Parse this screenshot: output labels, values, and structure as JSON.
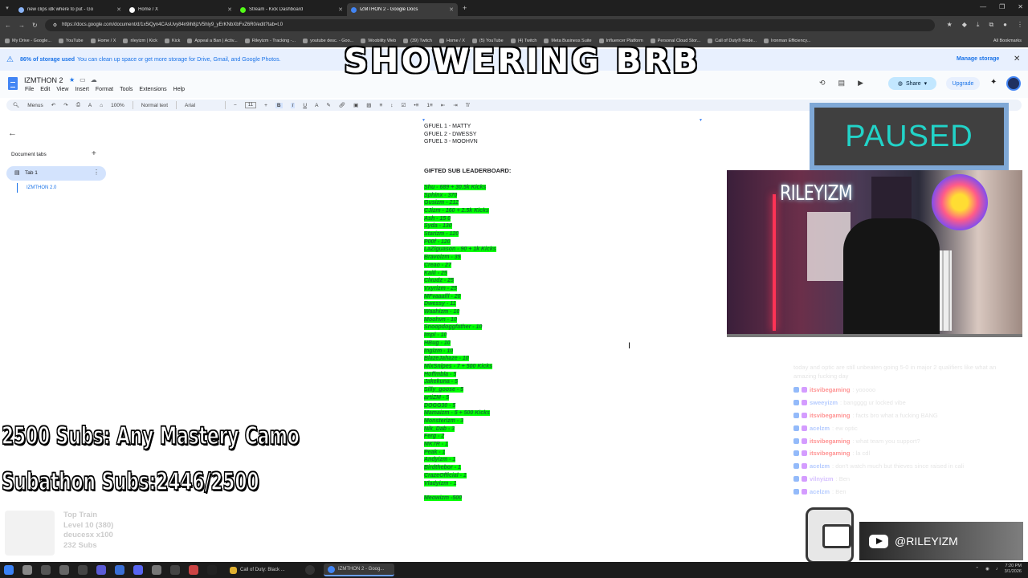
{
  "browser": {
    "tabs": [
      {
        "title": "new clips idk where to put - Go",
        "color": "#8ab4f8",
        "active": false
      },
      {
        "title": "Home / X",
        "color": "#ffffff",
        "active": false
      },
      {
        "title": "Stream - Kick Dashboard",
        "color": "#53fc18",
        "active": false
      },
      {
        "title": "IZMTHON 2 - Google Docs",
        "color": "#4285f4",
        "active": true
      }
    ],
    "url": "https://docs.google.com/document/d/1x5iQyn4CAsUvy84n9ih8jzV5hly9_yErKNbXbFvZ6R0/edit?tab=t.0",
    "bookmarks": [
      "My Drive - Google...",
      "YouTube",
      "Home / X",
      "rileyizm | Kick",
      "Kick",
      "Appeal a Ban | Activ...",
      "Rileyizm - Tracking -...",
      "youtube desc. - Goo...",
      "Woobility Web",
      "(39) Twitch",
      "Home / X",
      "(5) YouTube",
      "(4) Twitch",
      "Meta Business Suite",
      "Influencer Platform",
      "Personal Cloud Stor...",
      "Call of Duty® Rede...",
      "Ironman Efficiency..."
    ],
    "all_bookmarks": "All Bookmarks"
  },
  "banner": {
    "bold": "86% of storage used",
    "text": "You can clean up space or get more storage for Drive, Gmail, and Google Photos.",
    "manage": "Manage storage"
  },
  "docs": {
    "title": "IZMTHON 2",
    "menu": [
      "File",
      "Edit",
      "View",
      "Insert",
      "Format",
      "Tools",
      "Extensions",
      "Help"
    ],
    "share": "Share",
    "upgrade": "Upgrade"
  },
  "toolbar": {
    "menus": "Menus",
    "zoom": "100%",
    "style": "Normal text",
    "font": "Arial",
    "size": "11"
  },
  "sidebar": {
    "label": "Document tabs",
    "tab": "Tab 1",
    "outline": "IZMTHON 2.0"
  },
  "document": {
    "gfuel": [
      "GFUEL 1 - MATTY",
      "GFUEL 2 - DWESSY",
      "GFUEL 3 - MOOHVN"
    ],
    "heading": "GIFTED SUB LEADERBOARD:",
    "leaderboard": [
      "Shu - 689 + 30.5k Kicks",
      "Sphinx - 370",
      "Gusizm - 212",
      "CJizm - 160 + 2.5k Kicks",
      "Ash - 15        0",
      "Syda - 130",
      "Starizm - 120",
      "P00f - 120",
      "LaZiguason - 90 + 1k Kicks",
      "Bravoizm - 35",
      "Creao - 27",
      "Kaili - 25",
      "Clxudz - 25",
      "Vxyrizm - 25",
      "MFvaaalll - 20",
      "Dwessy - 11",
      "Waahizm - 10",
      "Moohvn - 10",
      "Snoopdoggfather - 10",
      "Impl - 10",
      "HBug - 10",
      "Ingizm - 10",
      "BlazeJahaze - 10",
      "MixSnipes - 7 + 500 Kicks",
      "Hoffmbla - 5",
      "Jakekuna - 5",
      "Silly_goose - 5",
      "artiZM - 5",
      "DOGG30 - 5",
      "Mamaizm - 5 + 500 Kicks",
      "Monsterizm - 3",
      "Nik_Dab - 3",
      "Ferg - 2",
      "MK7R - 1",
      "Peak - 1",
      "Andyizm - 1",
      "Birdthebor - 1",
      "CrazeOfficial - 1",
      "Vladyizm - 1"
    ],
    "final": "Meowizm -500"
  },
  "overlay": {
    "brb": "SHOWERING BRB",
    "paused": "PAUSED",
    "cam_name": "RILEYIZM",
    "goal1": "2500 Subs: Any Mastery Camo",
    "goal2": "Subathon Subs:2446/2500",
    "train": [
      "Top Train",
      "Level 10  (380)",
      "deucesx x100",
      "232 Subs"
    ],
    "yt_handle": "@RILEYIZM"
  },
  "chat": {
    "intro": "today and optic are still unbeaten going 5-0 in major 2 qualifiers like what an amazing fucking day",
    "messages": [
      {
        "user": "itsvibegaming",
        "text": ": yooooo",
        "color": "red"
      },
      {
        "user": "sweeyizm",
        "text": ": bangggg ur locked vibe",
        "color": "blue"
      },
      {
        "user": "itsvibegaming",
        "text": ": facts bro what a fucking BANG",
        "color": "red"
      },
      {
        "user": "acelzm",
        "text": ": ew optic",
        "color": "blue"
      },
      {
        "user": "itsvibegaming",
        "text": ": what team you support?",
        "color": "red"
      },
      {
        "user": "itsvibegaming",
        "text": ": la cdl",
        "color": "red"
      },
      {
        "user": "acelzm",
        "text": ": don't watch much but thieves since raised in cali",
        "color": "blue"
      },
      {
        "user": "vilnyizm",
        "text": ": Ben",
        "color": "purple"
      },
      {
        "user": "acelzm",
        "text": ": Ben",
        "color": "blue"
      }
    ]
  },
  "taskbar": {
    "apps": [
      "Call of Duty: Black ...",
      "IZMTHON 2 - Goog..."
    ],
    "time": "7:20 PM",
    "date": "3/1/2026"
  }
}
